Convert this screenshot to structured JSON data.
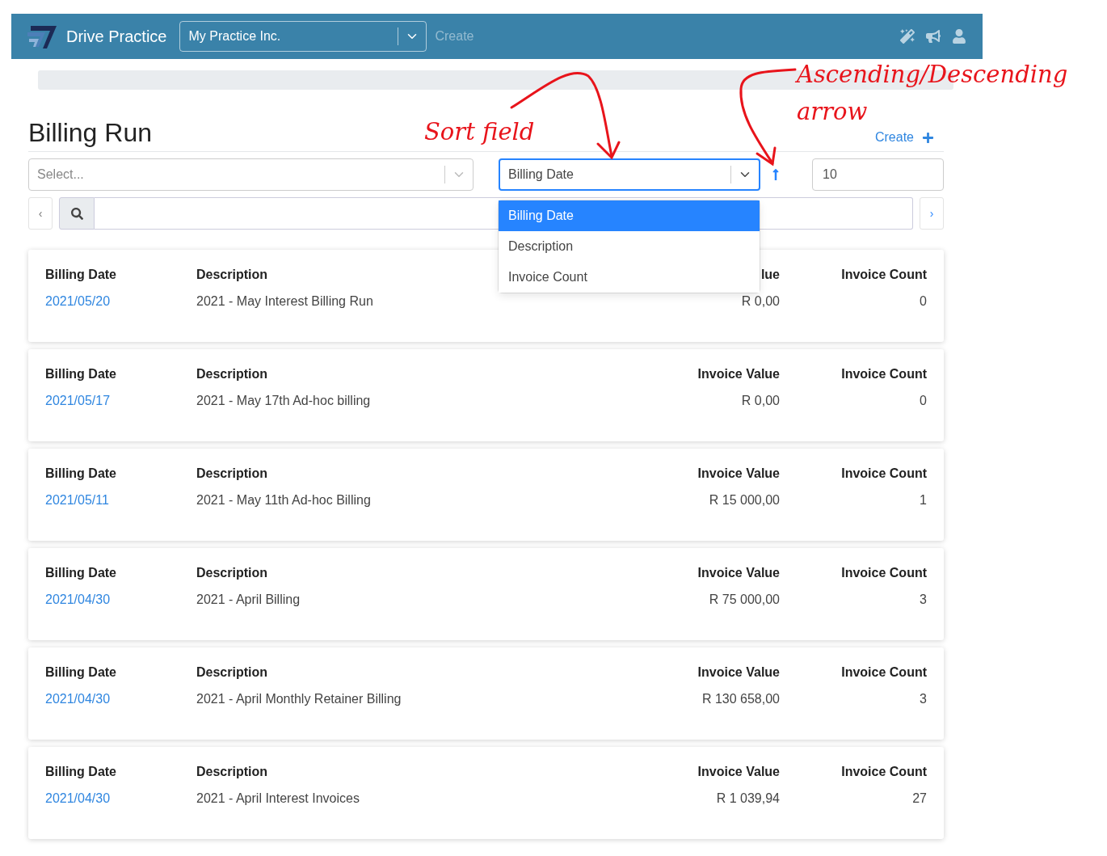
{
  "topbar": {
    "brand": "Drive Practice",
    "company_select": {
      "value": "My Practice Inc."
    },
    "create_link": "Create"
  },
  "page": {
    "title": "Billing Run",
    "create_link": "Create"
  },
  "filter_select": {
    "placeholder": "Select..."
  },
  "sort_select": {
    "value": "Billing Date",
    "expanded": true,
    "options": [
      {
        "label": "Billing Date",
        "selected": true
      },
      {
        "label": "Description",
        "selected": false
      },
      {
        "label": "Invoice Count",
        "selected": false
      }
    ]
  },
  "sort_ascending": true,
  "page_size": {
    "value": "10"
  },
  "pager": {
    "previous": "‹",
    "next": "›"
  },
  "cards": [
    {
      "labels": [
        "Billing Date",
        "Description",
        "lue",
        "Invoice Count"
      ],
      "billing_date": "2021/05/20",
      "description": "2021 - May Interest Billing Run",
      "invoice_value": "R 0,00",
      "invoice_count": "0"
    },
    {
      "labels": [
        "Billing Date",
        "Description",
        "Invoice Value",
        "Invoice Count"
      ],
      "billing_date": "2021/05/17",
      "description": "2021 - May 17th Ad-hoc billing",
      "invoice_value": "R 0,00",
      "invoice_count": "0"
    },
    {
      "labels": [
        "Billing Date",
        "Description",
        "Invoice Value",
        "Invoice Count"
      ],
      "billing_date": "2021/05/11",
      "description": "2021 - May 11th Ad-hoc Billing",
      "invoice_value": "R 15 000,00",
      "invoice_count": "1"
    },
    {
      "labels": [
        "Billing Date",
        "Description",
        "Invoice Value",
        "Invoice Count"
      ],
      "billing_date": "2021/04/30",
      "description": "2021 - April Billing",
      "invoice_value": "R 75 000,00",
      "invoice_count": "3"
    },
    {
      "labels": [
        "Billing Date",
        "Description",
        "Invoice Value",
        "Invoice Count"
      ],
      "billing_date": "2021/04/30",
      "description": "2021 - April Monthly Retainer Billing",
      "invoice_value": "R 130 658,00",
      "invoice_count": "3"
    },
    {
      "labels": [
        "Billing Date",
        "Description",
        "Invoice Value",
        "Invoice Count"
      ],
      "billing_date": "2021/04/30",
      "description": "2021 - April Interest Invoices",
      "invoice_value": "R 1 039,94",
      "invoice_count": "27"
    }
  ],
  "annotations": [
    {
      "text": "Sort field"
    },
    {
      "text": "Ascending/Descending"
    },
    {
      "text": "arrow"
    }
  ]
}
